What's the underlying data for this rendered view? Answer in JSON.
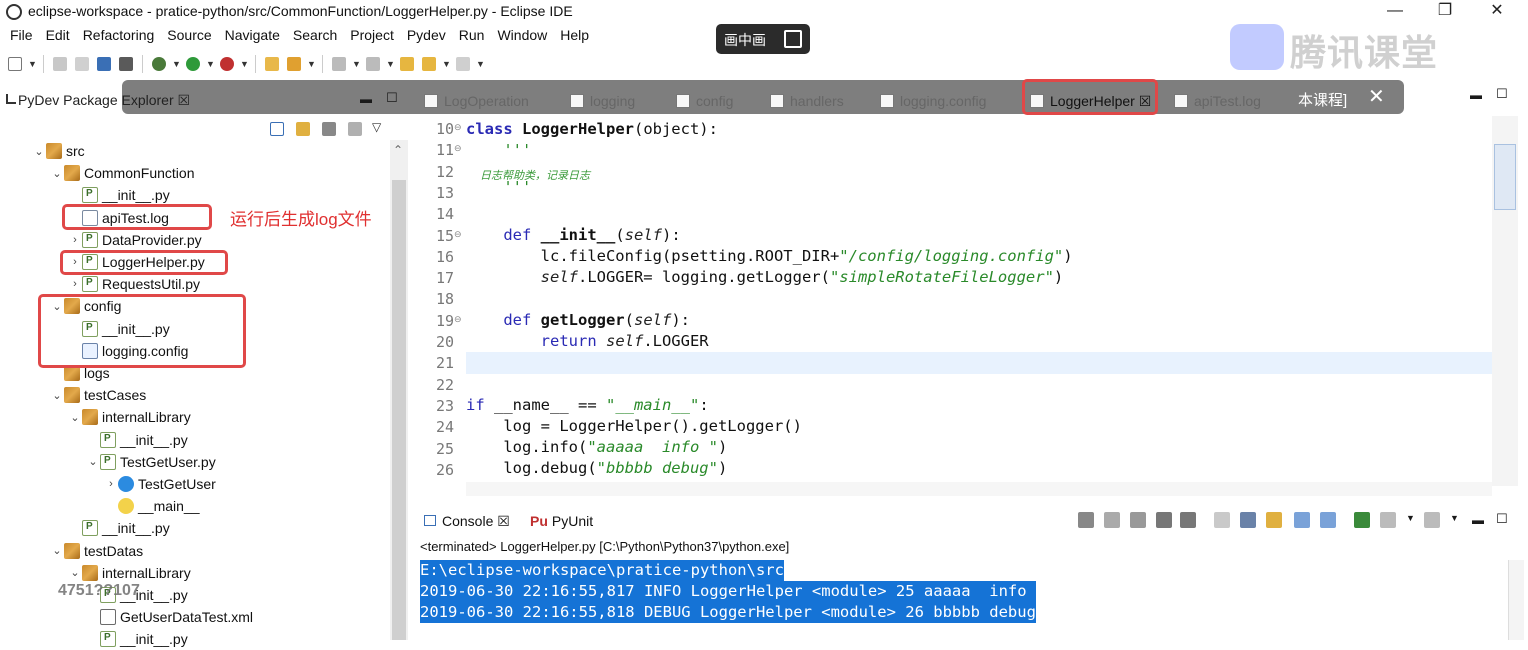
{
  "window": {
    "title": "eclipse-workspace - pratice-python/src/CommonFunction/LoggerHelper.py - Eclipse IDE",
    "controls": [
      "—",
      "❐",
      "✕"
    ]
  },
  "menu": [
    "File",
    "Edit",
    "Refactoring",
    "Source",
    "Navigate",
    "Search",
    "Project",
    "Pydev",
    "Run",
    "Window",
    "Help"
  ],
  "overlay": {
    "pip_label": "画中画",
    "course_label": "本课程]",
    "close": "✕",
    "brand_text": "腾讯课堂"
  },
  "package_explorer": {
    "title": "PyDev Package Explorer ☒",
    "tree": [
      {
        "label": "src",
        "icon": "pkg",
        "twisty": "⌄"
      },
      {
        "label": "CommonFunction",
        "icon": "pkg",
        "twisty": "⌄"
      },
      {
        "label": "__init__.py",
        "icon": "py",
        "twisty": ""
      },
      {
        "label": "apiTest.log",
        "icon": "log",
        "twisty": ""
      },
      {
        "label": "DataProvider.py",
        "icon": "py",
        "twisty": "›"
      },
      {
        "label": "LoggerHelper.py",
        "icon": "py",
        "twisty": "›"
      },
      {
        "label": "RequestsUtil.py",
        "icon": "py",
        "twisty": "›"
      },
      {
        "label": "config",
        "icon": "pkg",
        "twisty": "⌄"
      },
      {
        "label": "__init__.py",
        "icon": "py",
        "twisty": ""
      },
      {
        "label": "logging.config",
        "icon": "cfg",
        "twisty": ""
      },
      {
        "label": "logs",
        "icon": "pkg",
        "twisty": ""
      },
      {
        "label": "testCases",
        "icon": "pkg",
        "twisty": "⌄"
      },
      {
        "label": "internalLibrary",
        "icon": "pkg",
        "twisty": "⌄"
      },
      {
        "label": "__init__.py",
        "icon": "py",
        "twisty": ""
      },
      {
        "label": "TestGetUser.py",
        "icon": "py",
        "twisty": "⌄"
      },
      {
        "label": "TestGetUser",
        "icon": "cls",
        "twisty": "›"
      },
      {
        "label": "__main__",
        "icon": "main",
        "twisty": ""
      },
      {
        "label": "__init__.py",
        "icon": "py",
        "twisty": ""
      },
      {
        "label": "testDatas",
        "icon": "pkg",
        "twisty": "⌄"
      },
      {
        "label": "internalLibrary",
        "icon": "pkg",
        "twisty": "⌄"
      },
      {
        "label": "__init__.py",
        "icon": "py",
        "twisty": ""
      },
      {
        "label": "GetUserDataTest.xml",
        "icon": "xml",
        "twisty": ""
      },
      {
        "label": "__init__.py",
        "icon": "py",
        "twisty": ""
      }
    ],
    "annotation": "运行后生成log文件",
    "watermark": "4751??107"
  },
  "editor_tabs": [
    {
      "label": "LogOperation"
    },
    {
      "label": "logging"
    },
    {
      "label": "config"
    },
    {
      "label": "handlers"
    },
    {
      "label": "logging.config"
    },
    {
      "label": "LoggerHelper ☒"
    },
    {
      "label": "apiTest.log"
    }
  ],
  "editor": {
    "lines": [
      {
        "n": "10",
        "fold": "⊖"
      },
      {
        "n": "11",
        "fold": "⊖"
      },
      {
        "n": "12",
        "fold": ""
      },
      {
        "n": "13",
        "fold": ""
      },
      {
        "n": "14",
        "fold": ""
      },
      {
        "n": "15",
        "fold": "⊖"
      },
      {
        "n": "16",
        "fold": ""
      },
      {
        "n": "17",
        "fold": ""
      },
      {
        "n": "18",
        "fold": ""
      },
      {
        "n": "19",
        "fold": "⊖"
      },
      {
        "n": "20",
        "fold": ""
      },
      {
        "n": "21",
        "fold": ""
      },
      {
        "n": "22",
        "fold": ""
      },
      {
        "n": "23",
        "fold": ""
      },
      {
        "n": "24",
        "fold": ""
      },
      {
        "n": "25",
        "fold": ""
      },
      {
        "n": "26",
        "fold": ""
      }
    ],
    "code": {
      "l10_kw": "class ",
      "l10_name": "LoggerHelper",
      "l10_rest": "(object):",
      "l11": "    '''",
      "l12": "日志帮助类，记录日志",
      "l13": "    '''",
      "l15_kw": "    def ",
      "l15_name": "__init__",
      "l15_p1": "(",
      "l15_self": "self",
      "l15_p2": "):",
      "l16_a": "        lc.fileConfig(psetting.ROOT_DIR+",
      "l16_s": "\"/config/logging.config\"",
      "l16_b": ")",
      "l17_self": "        self",
      "l17_a": ".LOGGER= logging.getLogger(",
      "l17_s": "\"simpleRotateFileLogger\"",
      "l17_b": ")",
      "l19_kw": "    def ",
      "l19_name": "getLogger",
      "l19_p1": "(",
      "l19_self": "self",
      "l19_p2": "):",
      "l20_kw": "        return ",
      "l20_self": "self",
      "l20_b": ".LOGGER",
      "l23_kw": "if ",
      "l23_a": "__name__ == ",
      "l23_s": "\"__main__\"",
      "l23_b": ":",
      "l24": "    log = LoggerHelper().getLogger()",
      "l25_a": "    log.info(",
      "l25_s": "\"aaaaa  info \"",
      "l25_b": ")",
      "l26_a": "    log.debug(",
      "l26_s": "\"bbbbb debug\"",
      "l26_b": ")"
    }
  },
  "console": {
    "tab_console": "Console ☒",
    "tab_pyunit": "PyUnit",
    "status": "<terminated> LoggerHelper.py [C:\\Python\\Python37\\python.exe]",
    "output": [
      "E:\\eclipse-workspace\\pratice-python\\src",
      "2019-06-30 22:16:55,817 INFO LoggerHelper <module> 25 aaaaa  info ",
      "2019-06-30 22:16:55,818 DEBUG LoggerHelper <module> 26 bbbbb debug"
    ]
  },
  "colors": {
    "highlight_box": "#e04848",
    "console_selection": "#1573d6",
    "keyword": "#2a2ab4",
    "string": "#2a8a2a"
  }
}
